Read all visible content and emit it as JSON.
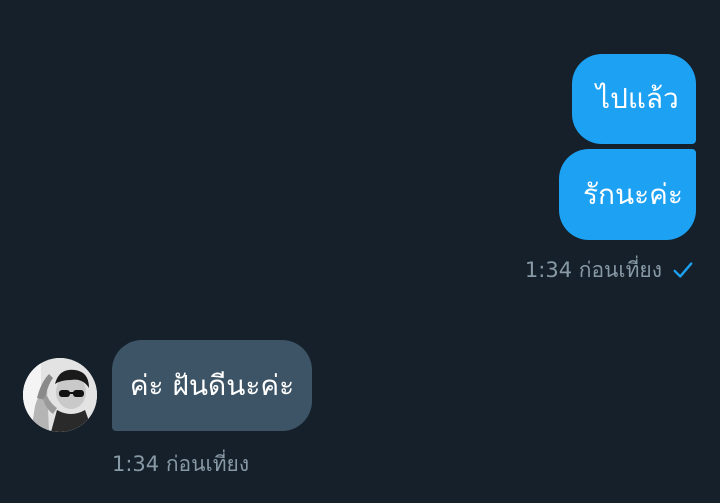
{
  "conversation": {
    "outgoing": [
      {
        "text": "ไปแล้ว"
      },
      {
        "text": "รักนะค่ะ"
      }
    ],
    "outgoing_timestamp": "1:34 ก่อนเที่ยง",
    "outgoing_status_icon": "checkmark-icon",
    "incoming": [
      {
        "text": "ค่ะ ฝันดีนะค่ะ"
      }
    ],
    "incoming_timestamp": "1:34 ก่อนเที่ยง",
    "incoming_avatar_icon": "avatar"
  },
  "colors": {
    "background": "#15202b",
    "outgoing_bubble": "#1da1f2",
    "incoming_bubble": "#3d5466",
    "meta_text": "#8899a6",
    "check": "#1da1f2"
  }
}
